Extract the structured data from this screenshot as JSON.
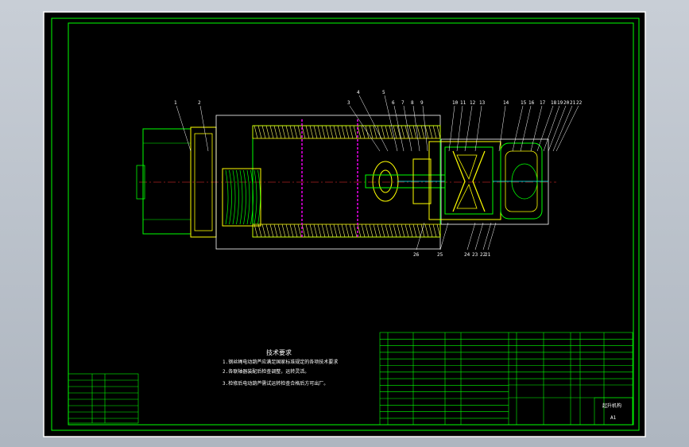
{
  "drawing": {
    "title_chinese": "技术要求",
    "requirements": [
      "1.钢丝绳电动葫芦应满足国家标准规定的各项技术要求",
      "2.各联轴器装配后检查调整，运转灵活。",
      "3.检修后电动葫芦需试运转检查合格后方可出厂。"
    ],
    "part_callouts_top": [
      "1",
      "2",
      "3",
      "4",
      "5",
      "6",
      "7",
      "8",
      "9",
      "10",
      "11",
      "12",
      "13",
      "14",
      "15",
      "16",
      "17",
      "18",
      "19",
      "20",
      "21",
      "22"
    ],
    "part_callouts_bottom": [
      "26",
      "25",
      "24",
      "23",
      "22",
      "21"
    ],
    "title_block": {
      "drawing_name": "起升机构",
      "sheet_size": "A1"
    }
  },
  "colors": {
    "background": "#000000",
    "border": "#00ff00",
    "outline": "#00ff00",
    "accent_yellow": "#ffff00",
    "section_magenta": "#ff00ff",
    "center_cyan": "#00ffff",
    "hatch": "#ffff66",
    "frame_white": "#ffffff"
  }
}
